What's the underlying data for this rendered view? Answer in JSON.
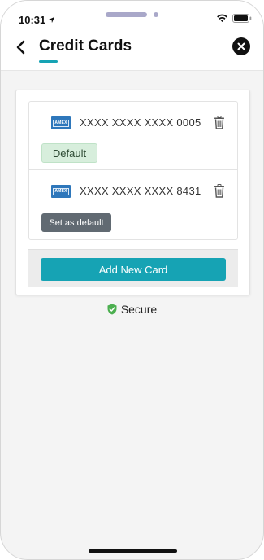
{
  "status_bar": {
    "time": "10:31",
    "icons": [
      "location-arrow-icon",
      "wifi-icon",
      "battery-icon"
    ]
  },
  "header": {
    "title": "Credit Cards",
    "back_icon": "chevron-left-icon",
    "close_icon": "close-icon"
  },
  "cards": [
    {
      "brand": "AMEX",
      "number": "XXXX XXXX XXXX 0005",
      "status_label": "Default",
      "is_default": true
    },
    {
      "brand": "AMEX",
      "number": "XXXX XXXX XXXX 8431",
      "status_label": "Set as default",
      "is_default": false
    }
  ],
  "actions": {
    "add_card_label": "Add New Card"
  },
  "footer": {
    "secure_label": "Secure"
  },
  "colors": {
    "accent": "#16a3b4",
    "default_badge_bg": "#d7eedc",
    "set_default_bg": "#616a72",
    "secure_shield": "#4caf50",
    "amex_blue": "#2e77bb"
  }
}
